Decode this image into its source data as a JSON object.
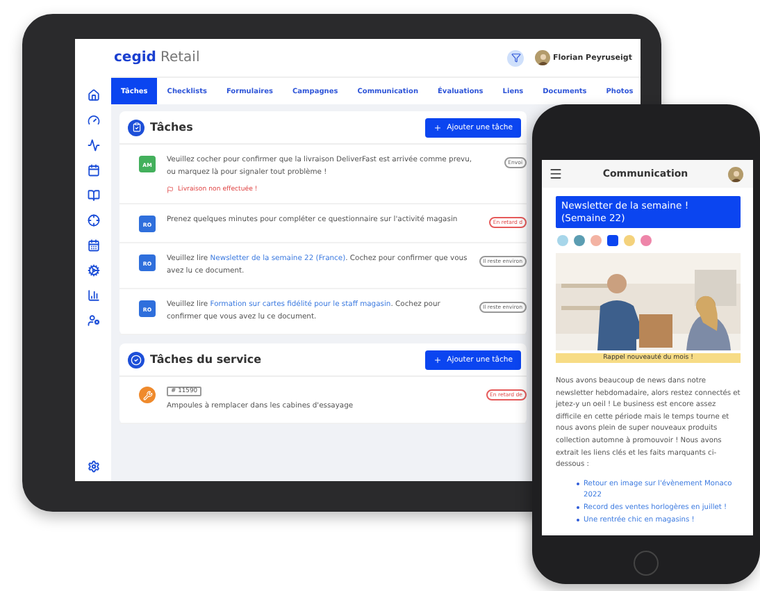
{
  "tablet": {
    "brand": {
      "name": "cegid",
      "product": "Retail"
    },
    "user": {
      "name": "Florian Peyruseigt"
    },
    "tabs": [
      {
        "label": "Tâches",
        "selected": true
      },
      {
        "label": "Checklists",
        "selected": false
      },
      {
        "label": "Formulaires",
        "selected": false
      },
      {
        "label": "Campagnes",
        "selected": false
      },
      {
        "label": "Communication",
        "selected": false
      },
      {
        "label": "Évaluations",
        "selected": false
      },
      {
        "label": "Liens",
        "selected": false
      },
      {
        "label": "Documents",
        "selected": false
      },
      {
        "label": "Photos",
        "selected": false
      }
    ],
    "tasks": {
      "title": "Tâches",
      "button": "Ajouter une tâche",
      "items": [
        {
          "initials": "AM",
          "color": "#43b05c",
          "text": "Veuillez cocher pour confirmer que la livraison DeliverFast est arrivée comme prevu, ou marquez là pour signaler tout problème !",
          "warning": "Livraison non effectuée !",
          "badge": {
            "text": "Envoi",
            "kind": "neutral"
          }
        },
        {
          "initials": "RO",
          "color": "#2f6fdc",
          "text": "Prenez quelques minutes pour compléter ce questionnaire sur l'activité magasin",
          "badge": {
            "text": "En retard d",
            "kind": "late"
          }
        },
        {
          "initials": "RO",
          "color": "#2f6fdc",
          "text": "Veuillez lire ",
          "link": "Newsletter de la semaine 22 (France)",
          "after": ". Cochez pour confirmer que vous avez lu ce document.",
          "badge": {
            "text": "Il reste environ",
            "kind": "neutral"
          }
        },
        {
          "initials": "RO",
          "color": "#2f6fdc",
          "text": "Veuillez lire ",
          "link": "Formation sur cartes fidélité pour le staff magasin",
          "after": ". Cochez pour confirmer que vous avez lu ce document.",
          "badge": {
            "text": "Il reste environ",
            "kind": "neutral"
          }
        }
      ]
    },
    "service": {
      "title": "Tâches du service",
      "button": "Ajouter une tâche",
      "items": [
        {
          "tag": "# 11590",
          "text": "Ampoules à remplacer dans les cabines d'essayage",
          "badge": {
            "text": "En retard de",
            "kind": "late"
          }
        }
      ]
    }
  },
  "phone": {
    "title": "Communication",
    "headline": "Newsletter de la semaine ! (Semaine 22)",
    "reactions": [
      {
        "color": "#a7d6ea",
        "selected": false
      },
      {
        "color": "#5b9db2",
        "selected": false
      },
      {
        "color": "#f3b3a3",
        "selected": false
      },
      {
        "color": "#0b45f0",
        "selected": true
      },
      {
        "color": "#f4d27c",
        "selected": false
      },
      {
        "color": "#ee85a9",
        "selected": false
      }
    ],
    "picture": {
      "kind": "picture"
    },
    "caption": "Rappel nouveauté du mois !",
    "paragraph": "Nous avons beaucoup de news dans notre newsletter hebdomadaire, alors restez connectés et jetez-y un oeil ! Le business est encore assez difficile en cette période mais le temps tourne et nous avons plein de super nouveaux produits collection automne à promouvoir ! Nous avons extrait les liens clés et les faits marquants ci-dessous :",
    "links": [
      "Retour en image sur l'évènement Monaco 2022",
      "Record des ventes horlogères en juillet !",
      "Une rentrée chic en magasins !"
    ]
  }
}
